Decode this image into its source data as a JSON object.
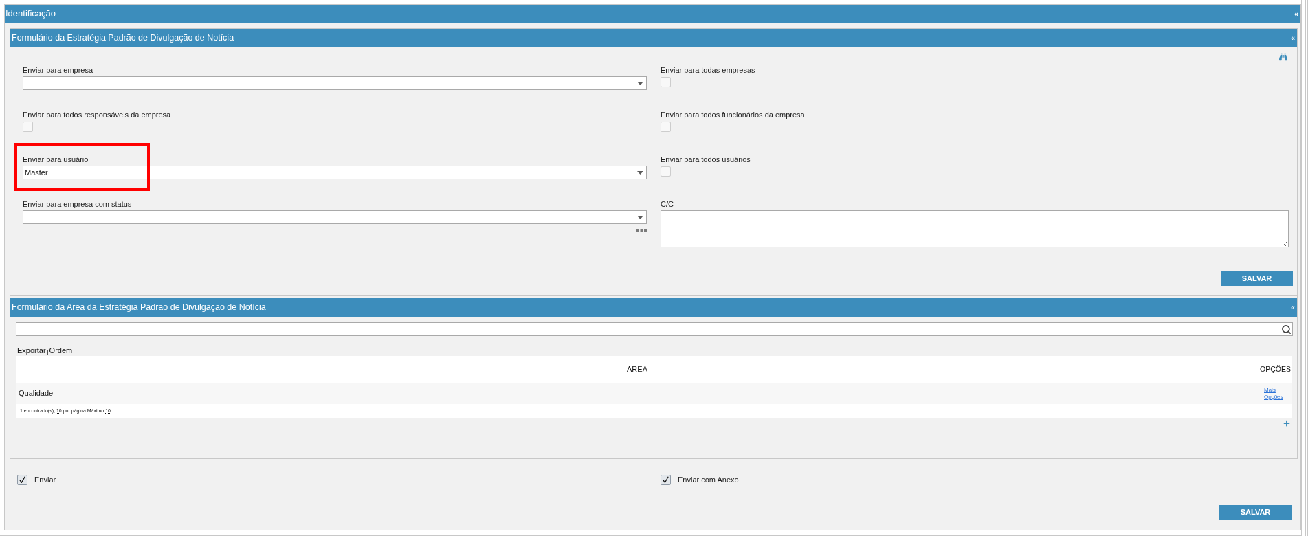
{
  "panel": {
    "title": "Identificação",
    "collapse": "«"
  },
  "strategy_form": {
    "title": "Formulário da Estratégia Padrão de Divulgação de Notícia",
    "collapse": "«",
    "fields": [
      {
        "kind": "select",
        "label": "Enviar para empresa"
      },
      {
        "kind": "checkbox",
        "label": "Enviar para todas empresas",
        "checked": false
      },
      {
        "kind": "checkbox",
        "label": "Enviar para todos responsáveis da empresa",
        "checked": false
      },
      {
        "kind": "checkbox",
        "label": "Enviar para todos funcionários da empresa",
        "checked": false
      },
      {
        "kind": "select",
        "label": "Enviar para usuário",
        "value": "Master",
        "highlighted": true
      },
      {
        "kind": "checkbox",
        "label": "Enviar para todos usuários",
        "checked": false
      },
      {
        "kind": "select",
        "label": "Enviar para empresa com status",
        "more_button": true
      },
      {
        "kind": "textarea",
        "label": "C/C"
      }
    ],
    "save_button": "SALVAR"
  },
  "area_form": {
    "title": "Formulário da Area da Estratégia Padrão de Divulgação de Notícia",
    "collapse": "«",
    "toolbar": [
      "Exportar",
      "Ordem"
    ],
    "table": {
      "columns": [
        "AREA",
        "OPÇÕES"
      ],
      "rows": [
        {
          "area": "Qualidade",
          "options_link": "Mais Opções"
        }
      ]
    },
    "pagination": {
      "before": "1 encontrado(s),",
      "per_page": "10",
      "middle": "por página.Máximo",
      "maximum": "10",
      "after": "."
    }
  },
  "footer": {
    "checkboxes": [
      {
        "label": "Enviar",
        "checked": true
      },
      {
        "label": "Enviar com Anexo",
        "checked": true
      }
    ],
    "save_button": "SALVAR"
  }
}
